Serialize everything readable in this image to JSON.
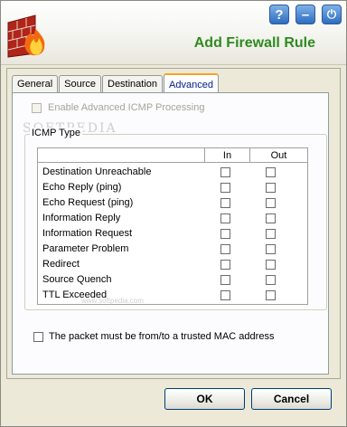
{
  "window": {
    "title": "Add Firewall Rule"
  },
  "header_buttons": [
    {
      "icon": "help-icon",
      "glyph": "?"
    },
    {
      "icon": "minimize-icon",
      "glyph": "–"
    },
    {
      "icon": "close-icon",
      "glyph": "⏻"
    }
  ],
  "tabs": [
    {
      "label": "General",
      "active": false
    },
    {
      "label": "Source",
      "active": false
    },
    {
      "label": "Destination",
      "active": false
    },
    {
      "label": "Advanced",
      "active": true
    }
  ],
  "advanced": {
    "enable_icmp_label": "Enable Advanced ICMP Processing",
    "enable_icmp_checked": false,
    "icmp_group_title": "ICMP Type",
    "columns": {
      "name": "",
      "in": "In",
      "out": "Out"
    },
    "rows": [
      {
        "label": "Destination Unreachable",
        "in": false,
        "out": false
      },
      {
        "label": "Echo Reply (ping)",
        "in": false,
        "out": false
      },
      {
        "label": "Echo Request (ping)",
        "in": false,
        "out": false
      },
      {
        "label": "Information Reply",
        "in": false,
        "out": false
      },
      {
        "label": "Information Request",
        "in": false,
        "out": false
      },
      {
        "label": "Parameter Problem",
        "in": false,
        "out": false
      },
      {
        "label": "Redirect",
        "in": false,
        "out": false
      },
      {
        "label": "Source Quench",
        "in": false,
        "out": false
      },
      {
        "label": "TTL Exceeded",
        "in": false,
        "out": false
      }
    ],
    "trusted_mac_label": "The packet must be from/to a trusted MAC address",
    "trusted_mac_checked": false
  },
  "watermark": {
    "text": "SOFTPEDIA",
    "url": "www.softpedia.com"
  },
  "buttons": {
    "ok": "OK",
    "cancel": "Cancel"
  },
  "colors": {
    "title": "#2e8b1f",
    "tab_accent": "#f5a623",
    "header_button": "#2d6cc0"
  }
}
